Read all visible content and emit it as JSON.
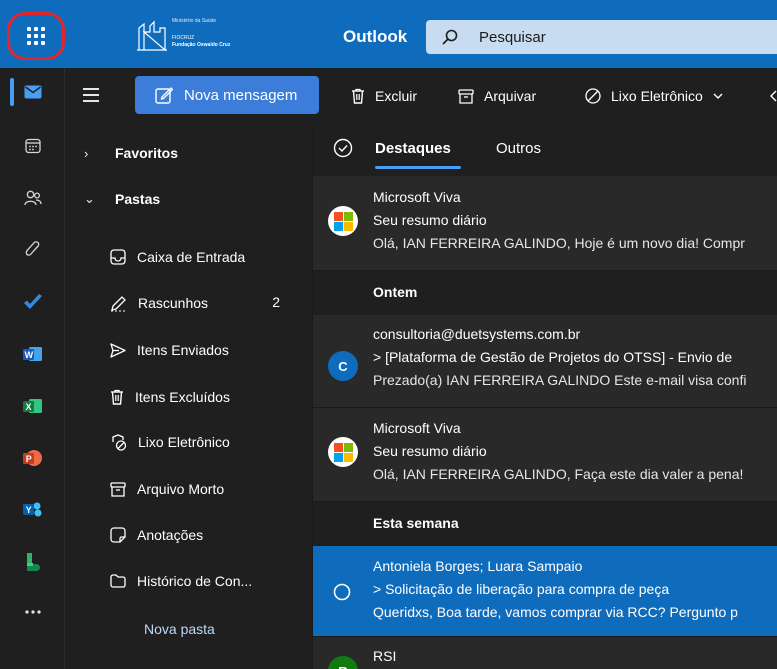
{
  "header": {
    "app_title": "Outlook",
    "brand": {
      "ministry": "Ministério da Saúde",
      "fiocruz": "FIOCRUZ",
      "foundation": "Fundação Oswaldo Cruz"
    },
    "search_placeholder": "Pesquisar",
    "colors": {
      "bar": "#0f6cbd",
      "highlight": "#e3262b"
    }
  },
  "rail": {
    "items": [
      {
        "icon": "mail-icon",
        "active": true
      },
      {
        "icon": "calendar-icon"
      },
      {
        "icon": "people-icon"
      },
      {
        "icon": "attachment-icon"
      },
      {
        "icon": "todo-icon"
      },
      {
        "icon": "word-icon"
      },
      {
        "icon": "excel-icon"
      },
      {
        "icon": "powerpoint-icon"
      },
      {
        "icon": "yammer-icon"
      },
      {
        "icon": "bookings-icon"
      },
      {
        "icon": "more-apps-icon"
      }
    ]
  },
  "toolbar": {
    "new_message": "Nova mensagem",
    "delete": "Excluir",
    "archive": "Arquivar",
    "junk": "Lixo Eletrônico"
  },
  "folders": {
    "favorites": "Favoritos",
    "folders_head": "Pastas",
    "items": [
      {
        "label": "Caixa de Entrada",
        "icon": "inbox-icon",
        "count": ""
      },
      {
        "label": "Rascunhos",
        "icon": "drafts-icon",
        "count": "2"
      },
      {
        "label": "Itens Enviados",
        "icon": "sent-icon",
        "count": ""
      },
      {
        "label": "Itens Excluídos",
        "icon": "trash-icon",
        "count": ""
      },
      {
        "label": "Lixo Eletrônico",
        "icon": "junk-icon",
        "count": ""
      },
      {
        "label": "Arquivo Morto",
        "icon": "archive-icon",
        "count": ""
      },
      {
        "label": "Anotações",
        "icon": "notes-icon",
        "count": ""
      },
      {
        "label": "Histórico de Con...",
        "icon": "folder-icon",
        "count": ""
      }
    ],
    "new_folder": "Nova pasta"
  },
  "list": {
    "tabs": {
      "focused": "Destaques",
      "other": "Outros"
    },
    "sections": {
      "yesterday": "Ontem",
      "this_week": "Esta semana"
    },
    "messages": [
      {
        "sender": "Microsoft Viva",
        "subject": "Seu resumo diário",
        "preview": "Olá, IAN FERREIRA GALINDO, Hoje é um novo dia! Compr"
      },
      {
        "sender": "consultoria@duetsystems.com.br",
        "subject": "> [Plataforma de Gestão de Projetos do OTSS] - Envio de",
        "preview": "Prezado(a) IAN FERREIRA GALINDO Este e-mail visa confi",
        "avatar_letter": "C",
        "avatar_color": "#0f6cbd"
      },
      {
        "sender": "Microsoft Viva",
        "subject": "Seu resumo diário",
        "preview": "Olá, IAN FERREIRA GALINDO, Faça este dia valer a pena!"
      },
      {
        "sender": "Antoniela Borges; Luara Sampaio",
        "subject": "> Solicitação de liberação para compra de peça",
        "preview": "Queridxs, Boa tarde, vamos comprar via RCC? Pergunto p",
        "selected": true
      },
      {
        "sender": "RSI",
        "avatar_letter": "R",
        "avatar_color": "#107c10"
      }
    ]
  }
}
